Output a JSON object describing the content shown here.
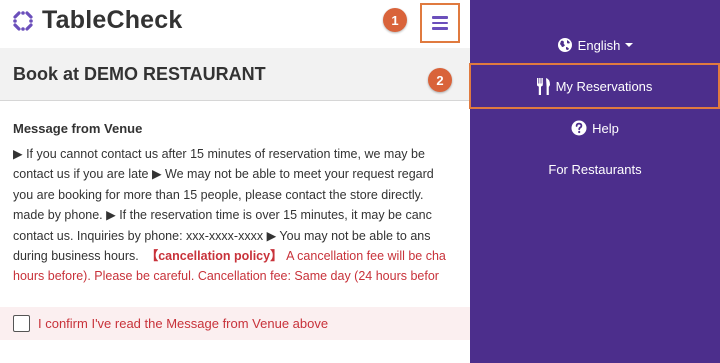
{
  "brand": {
    "name": "TableCheck",
    "color": "#6b4fbb"
  },
  "header": {
    "menu_icon": "hamburger-menu-icon"
  },
  "annotations": {
    "badge_1": "1",
    "badge_2": "2",
    "color": "#d9633a"
  },
  "page": {
    "title": "Book at DEMO RESTAURANT"
  },
  "message": {
    "heading": "Message from Venue",
    "lines": [
      "▶ If you cannot contact us after 15 minutes of reservation time, we may be",
      "contact us if you are late ▶ We may not be able to meet your request regard",
      "you are booking for more than 15 people, please contact the store directly.",
      "made by phone. ▶ If the reservation time is over 15 minutes, it may be canc",
      "contact us. Inquiries by phone: xxx-xxxx-xxxx ▶ You may not be able to ans",
      "during business hours.",
      "hours before). Please be careful. Cancellation fee: Same day (24 hours befor"
    ],
    "policy_label": "【cancellation policy】",
    "policy_text_line6": "A cancellation fee will be cha"
  },
  "confirm": {
    "label": "I confirm I've read the Message from Venue above",
    "checked": false
  },
  "drawer": {
    "background": "#4c2e8c",
    "items": [
      {
        "label": "English",
        "icon": "globe-icon"
      },
      {
        "label": "My Reservations",
        "icon": "fork-knife-icon"
      },
      {
        "label": "Help",
        "icon": "question-circle-icon"
      },
      {
        "label": "For Restaurants",
        "icon": ""
      }
    ]
  }
}
